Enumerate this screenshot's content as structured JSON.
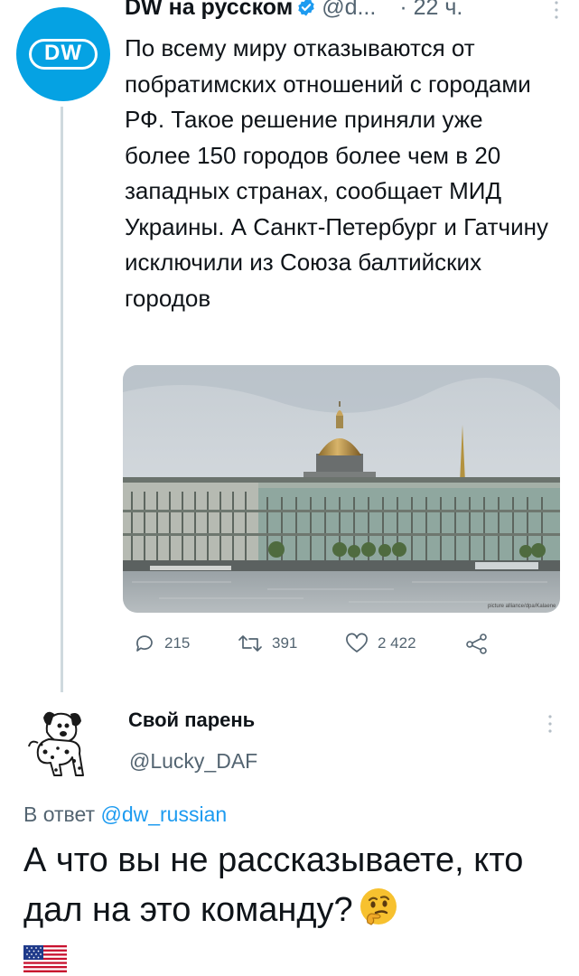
{
  "tweet": {
    "author": "DW на русском",
    "handle": "@d...",
    "time": "· 22 ч.",
    "text": "По всему миру отказываются от побратимских отношений с городами РФ. Такое решение приняли уже более 150 городов более чем в 20 западных странах, сообщает МИД Украины. А Санкт-Петербург и Гатчину исключили из Союза балтийских городов",
    "avatar_logo": "DW",
    "photo_credit": "picture alliance/dpa/Kalaene",
    "replies": "215",
    "retweets": "391",
    "likes": "2 422"
  },
  "reply": {
    "author": "Свой парень",
    "handle": "@Lucky_DAF",
    "reply_to_prefix": "В ответ",
    "reply_to_handle": "@dw_russian",
    "text": "А что вы не рассказываете, кто дал на это команду?"
  },
  "colors": {
    "brand_blue": "#05a2e3",
    "link": "#1d9bf0",
    "muted": "#536471",
    "text": "#0f1419"
  },
  "icons": [
    "verified-icon",
    "more-icon",
    "reply-icon",
    "retweet-icon",
    "like-icon",
    "share-icon",
    "thinking-face-emoji",
    "us-flag-icon"
  ]
}
